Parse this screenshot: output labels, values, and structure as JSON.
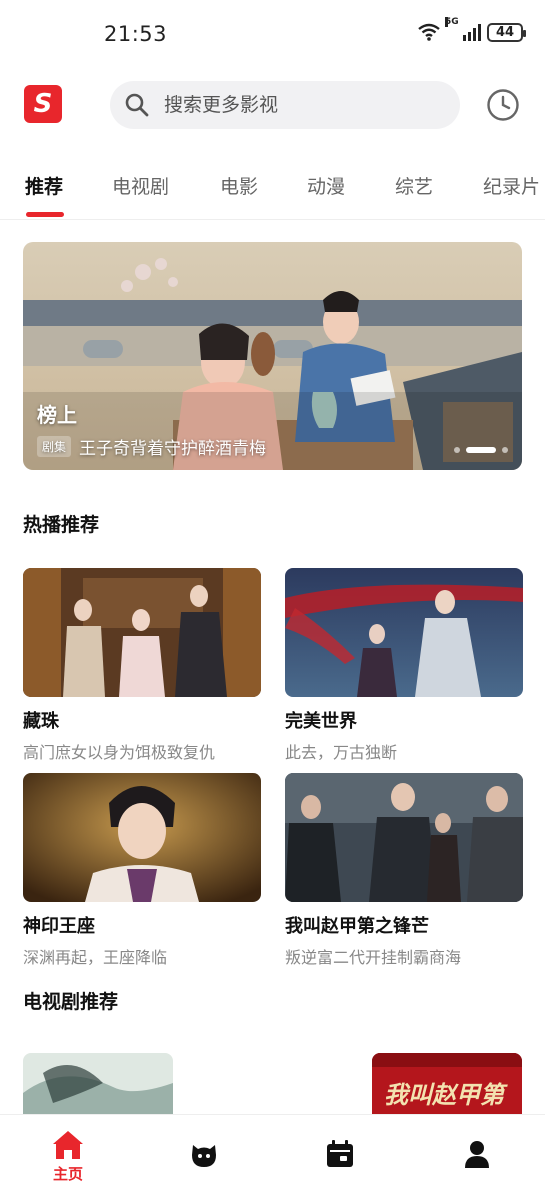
{
  "status_bar": {
    "time": "21:53",
    "network": "5G",
    "battery": "44"
  },
  "header": {
    "logo_letter": "S",
    "search_placeholder": "搜索更多影视",
    "accent": "#e8262c"
  },
  "tabs": [
    {
      "label": "推荐",
      "active": true
    },
    {
      "label": "电视剧"
    },
    {
      "label": "电影"
    },
    {
      "label": "动漫"
    },
    {
      "label": "综艺"
    },
    {
      "label": "纪录片"
    }
  ],
  "banner": {
    "title": "榜上",
    "badge": "剧集",
    "subtitle": "王子奇背着守护醉酒青梅"
  },
  "hot_section": {
    "title": "热播推荐",
    "items": [
      {
        "name": "藏珠",
        "desc": "高门庶女以身为饵极致复仇"
      },
      {
        "name": "完美世界",
        "desc": "此去，万古独断"
      },
      {
        "name": "神印王座",
        "desc": "深渊再起，王座降临"
      },
      {
        "name": "我叫赵甲第之锋芒",
        "desc": "叛逆富二代开挂制霸商海"
      }
    ]
  },
  "tv_section": {
    "title": "电视剧推荐",
    "poster_text": "我叫赵甲第"
  },
  "bottom_nav": {
    "home_label": "主页"
  }
}
